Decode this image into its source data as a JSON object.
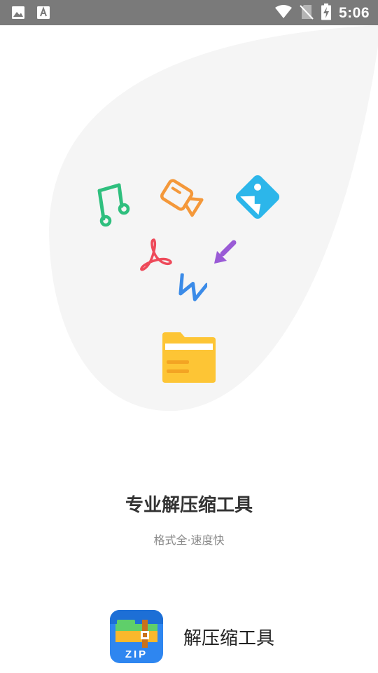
{
  "status_bar": {
    "time": "5:06",
    "left_icons": [
      "image-notification-icon",
      "text-notification-icon"
    ],
    "right_icons": [
      "wifi-icon",
      "no-sim-icon",
      "battery-charging-icon"
    ]
  },
  "illustration": {
    "icons": [
      "music-icon",
      "video-icon",
      "image-icon",
      "pdf-icon",
      "arrow-icon",
      "word-icon",
      "folder-icon"
    ],
    "colors": {
      "blob": "#f5f5f5",
      "music": "#2fbf7e",
      "video": "#f4983a",
      "image": "#2cb6ea",
      "pdf": "#ee4a5a",
      "arrow": "#9a5bd6",
      "word": "#3b8be8",
      "folder": "#fdc535"
    }
  },
  "headline": "专业解压缩工具",
  "tagline": "格式全·速度快",
  "app": {
    "logo_text": "ZIP",
    "name": "解压缩工具",
    "logo_colors": {
      "top": "#f9b82c",
      "bottom": "#2e86f0",
      "strap": "#c9711d"
    }
  }
}
